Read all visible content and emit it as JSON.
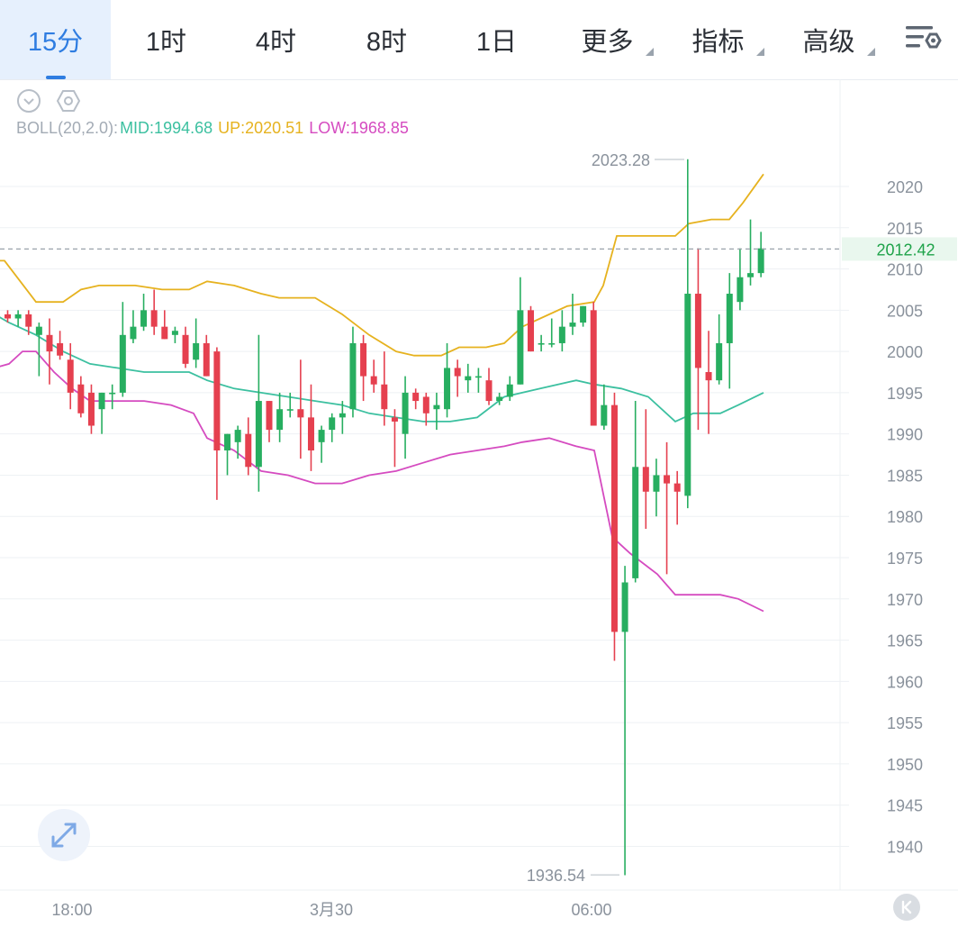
{
  "tabs": [
    {
      "label": "15分",
      "active": true
    },
    {
      "label": "1时"
    },
    {
      "label": "4时"
    },
    {
      "label": "8时"
    },
    {
      "label": "1日"
    },
    {
      "label": "更多",
      "dropdown": true
    },
    {
      "label": "指标",
      "dropdown": true
    },
    {
      "label": "高级",
      "dropdown": true
    }
  ],
  "icons": {
    "settings": "chart-settings-icon",
    "collapse": "chevron-down-circle-icon",
    "indicator_settings": "hexagon-settings-icon",
    "fullscreen": "expand-arrows-icon",
    "k": "k-icon"
  },
  "boll": {
    "name": "BOLL(20,2.0):",
    "mid": "MID:1994.68",
    "up": "UP:2020.51",
    "low": "LOW:1968.85"
  },
  "colors": {
    "accent": "#2f7de1",
    "up_candle": "#27ae60",
    "down_candle": "#e5404f",
    "mid": "#3cc0a0",
    "upper": "#e6b21f",
    "lower": "#d54bc0",
    "last_price": "#1fa34a"
  },
  "chart_data": {
    "type": "candlestick",
    "interval": "15分",
    "ylim": [
      1934,
      2026
    ],
    "y_ticks": [
      2020,
      2015,
      2010,
      2005,
      2000,
      1995,
      1990,
      1985,
      1980,
      1975,
      1970,
      1965,
      1960,
      1955,
      1950,
      1945,
      1940
    ],
    "x_ticks": [
      "18:00",
      "3月30",
      "06:00"
    ],
    "last_price": 2012.42,
    "max_label": "2023.28",
    "min_label": "1936.54",
    "candles": [
      [
        2004.5,
        2005.0,
        2003.5,
        2004.0
      ],
      [
        2004.0,
        2005.0,
        2003.0,
        2004.5
      ],
      [
        2004.5,
        2005.0,
        2002.0,
        2003.0
      ],
      [
        2002.0,
        2003.5,
        1997.0,
        2003.0
      ],
      [
        2002.0,
        2004.0,
        1996.0,
        2000.0
      ],
      [
        2001.0,
        2002.5,
        1999.0,
        1999.5
      ],
      [
        1999.0,
        2001.0,
        1993.0,
        1995.0
      ],
      [
        1996.0,
        1997.0,
        1992.0,
        1992.5
      ],
      [
        1995.0,
        1996.0,
        1990.0,
        1991.0
      ],
      [
        1993.0,
        1995.0,
        1990.0,
        1995.0
      ],
      [
        1995.0,
        1996.0,
        1993.0,
        1995.0
      ],
      [
        1995.0,
        2006.0,
        1994.5,
        2002.0
      ],
      [
        2001.5,
        2005.0,
        2001.0,
        2003.0
      ],
      [
        2003.0,
        2007.0,
        2002.5,
        2005.0
      ],
      [
        2005.0,
        2007.5,
        2002.0,
        2003.0
      ],
      [
        2003.0,
        2005.0,
        2001.5,
        2001.5
      ],
      [
        2002.0,
        2003.0,
        2001.0,
        2002.5
      ],
      [
        2002.0,
        2003.0,
        1998.0,
        1998.5
      ],
      [
        1999.0,
        2004.0,
        1998.0,
        2001.0
      ],
      [
        2001.0,
        2002.0,
        1997.0,
        1997.0
      ],
      [
        2000.0,
        2000.5,
        1982.0,
        1988.0
      ],
      [
        1988.0,
        1990.0,
        1985.0,
        1990.0
      ],
      [
        1989.0,
        1991.0,
        1987.0,
        1990.5
      ],
      [
        1990.0,
        1992.0,
        1985.0,
        1986.0
      ],
      [
        1986.0,
        2002.0,
        1983.0,
        1994.0
      ],
      [
        1994.0,
        1994.0,
        1989.0,
        1990.5
      ],
      [
        1990.5,
        1995.0,
        1989.0,
        1993.0
      ],
      [
        1993.0,
        1995.0,
        1992.0,
        1993.0
      ],
      [
        1993.0,
        1999.0,
        1987.0,
        1992.0
      ],
      [
        1992.0,
        1996.0,
        1985.5,
        1988.0
      ],
      [
        1989.0,
        1991.0,
        1986.5,
        1990.5
      ],
      [
        1990.5,
        1992.5,
        1989.0,
        1992.0
      ],
      [
        1992.0,
        1994.0,
        1990.0,
        1992.5
      ],
      [
        1993.0,
        2003.0,
        1992.0,
        2001.0
      ],
      [
        2001.0,
        2002.0,
        1994.0,
        1997.0
      ],
      [
        1997.0,
        1999.0,
        1995.0,
        1996.0
      ],
      [
        1996.0,
        2000.0,
        1991.0,
        1993.0
      ],
      [
        1992.0,
        1993.0,
        1986.0,
        1991.5
      ],
      [
        1990.0,
        1997.0,
        1987.0,
        1995.0
      ],
      [
        1995.0,
        1995.5,
        1993.0,
        1994.0
      ],
      [
        1994.5,
        1995.0,
        1991.0,
        1992.5
      ],
      [
        1993.0,
        1995.0,
        1990.5,
        1993.5
      ],
      [
        1993.0,
        2001.0,
        1992.0,
        1998.0
      ],
      [
        1998.0,
        1999.0,
        1994.5,
        1997.0
      ],
      [
        1996.5,
        1998.5,
        1995.0,
        1997.0
      ],
      [
        1997.0,
        1998.0,
        1995.0,
        1997.0
      ],
      [
        1996.5,
        1998.0,
        1993.5,
        1994.0
      ],
      [
        1994.0,
        1995.0,
        1993.5,
        1994.5
      ],
      [
        1994.5,
        1997.0,
        1994.0,
        1996.0
      ],
      [
        1996.0,
        2009.0,
        1996.0,
        2005.0
      ],
      [
        2005.0,
        2005.5,
        2000.0,
        2000.0
      ],
      [
        2001.0,
        2002.0,
        2000.0,
        2001.0
      ],
      [
        2001.0,
        2004.0,
        2000.5,
        2001.0
      ],
      [
        2001.0,
        2005.0,
        2000.0,
        2003.0
      ],
      [
        2003.0,
        2007.0,
        2002.0,
        2003.5
      ],
      [
        2003.5,
        2005.5,
        2003.0,
        2005.5
      ],
      [
        2005.0,
        2006.0,
        1995.0,
        1991.0
      ],
      [
        1991.0,
        1996.0,
        1990.5,
        1993.5
      ],
      [
        1993.5,
        1995.0,
        1962.5,
        1966.0
      ],
      [
        1966.0,
        1974.0,
        1936.5,
        1972.0
      ],
      [
        1972.5,
        1994.0,
        1972.0,
        1986.0
      ],
      [
        1986.0,
        1993.0,
        1978.5,
        1983.0
      ],
      [
        1983.0,
        1987.0,
        1980.0,
        1985.0
      ],
      [
        1985.0,
        1989.0,
        1973.0,
        1984.0
      ],
      [
        1984.0,
        1985.5,
        1979.0,
        1983.0
      ],
      [
        1982.5,
        2023.3,
        1981.0,
        2007.0
      ],
      [
        2007.0,
        2012.5,
        1990.5,
        1998.0
      ],
      [
        1997.5,
        2002.5,
        1990.0,
        1996.5
      ],
      [
        1996.5,
        2004.5,
        1996.0,
        2001.0
      ],
      [
        2001.0,
        2009.5,
        1995.5,
        2007.0
      ],
      [
        2006.0,
        2012.5,
        2005.0,
        2009.0
      ],
      [
        2009.0,
        2016.0,
        2008.0,
        2009.5
      ],
      [
        2009.5,
        2014.5,
        2009.0,
        2012.5
      ]
    ],
    "bands": {
      "upper": [
        [
          -6,
          2011.0
        ],
        [
          5,
          2011.0
        ],
        [
          40,
          2006.0
        ],
        [
          70,
          2006.0
        ],
        [
          90,
          2007.5
        ],
        [
          110,
          2008.0
        ],
        [
          150,
          2008.0
        ],
        [
          180,
          2007.5
        ],
        [
          210,
          2007.5
        ],
        [
          230,
          2008.5
        ],
        [
          260,
          2008.0
        ],
        [
          290,
          2007.0
        ],
        [
          310,
          2006.5
        ],
        [
          350,
          2006.5
        ],
        [
          380,
          2004.5
        ],
        [
          410,
          2002.0
        ],
        [
          440,
          2000.0
        ],
        [
          460,
          1999.5
        ],
        [
          490,
          1999.5
        ],
        [
          510,
          2000.5
        ],
        [
          540,
          2000.5
        ],
        [
          560,
          2001.0
        ],
        [
          580,
          2003.0
        ],
        [
          600,
          2004.0
        ],
        [
          630,
          2005.5
        ],
        [
          660,
          2006.0
        ],
        [
          670,
          2008.0
        ],
        [
          685,
          2014.0
        ],
        [
          720,
          2014.0
        ],
        [
          750,
          2014.0
        ],
        [
          765,
          2015.5
        ],
        [
          790,
          2016.0
        ],
        [
          810,
          2016.0
        ],
        [
          825,
          2018.0
        ],
        [
          848,
          2021.5
        ]
      ],
      "mid": [
        [
          -6,
          2004.5
        ],
        [
          10,
          2003.5
        ],
        [
          40,
          2002.0
        ],
        [
          70,
          2000.0
        ],
        [
          100,
          1998.5
        ],
        [
          130,
          1998.0
        ],
        [
          160,
          1997.5
        ],
        [
          190,
          1997.5
        ],
        [
          210,
          1997.5
        ],
        [
          230,
          1996.5
        ],
        [
          260,
          1995.5
        ],
        [
          290,
          1995.0
        ],
        [
          320,
          1994.5
        ],
        [
          350,
          1994.0
        ],
        [
          380,
          1993.5
        ],
        [
          410,
          1992.5
        ],
        [
          440,
          1992.0
        ],
        [
          470,
          1991.5
        ],
        [
          500,
          1991.5
        ],
        [
          530,
          1992.0
        ],
        [
          560,
          1994.5
        ],
        [
          600,
          1995.5
        ],
        [
          640,
          1996.5
        ],
        [
          660,
          1996.0
        ],
        [
          690,
          1995.5
        ],
        [
          720,
          1994.5
        ],
        [
          750,
          1991.5
        ],
        [
          770,
          1992.5
        ],
        [
          800,
          1992.5
        ],
        [
          820,
          1993.5
        ],
        [
          848,
          1995.0
        ]
      ],
      "lower": [
        [
          -6,
          1998.0
        ],
        [
          10,
          1998.5
        ],
        [
          25,
          2000.0
        ],
        [
          40,
          2000.0
        ],
        [
          60,
          1997.5
        ],
        [
          80,
          1995.5
        ],
        [
          100,
          1994.0
        ],
        [
          130,
          1994.0
        ],
        [
          160,
          1994.0
        ],
        [
          190,
          1993.5
        ],
        [
          215,
          1992.5
        ],
        [
          230,
          1989.5
        ],
        [
          260,
          1988.0
        ],
        [
          290,
          1985.5
        ],
        [
          320,
          1985.0
        ],
        [
          350,
          1984.0
        ],
        [
          380,
          1984.0
        ],
        [
          410,
          1985.0
        ],
        [
          440,
          1985.5
        ],
        [
          470,
          1986.5
        ],
        [
          500,
          1987.5
        ],
        [
          530,
          1988.0
        ],
        [
          560,
          1988.5
        ],
        [
          580,
          1989.0
        ],
        [
          610,
          1989.5
        ],
        [
          640,
          1988.5
        ],
        [
          660,
          1988.0
        ],
        [
          680,
          1977.5
        ],
        [
          700,
          1975.5
        ],
        [
          730,
          1973.0
        ],
        [
          750,
          1970.5
        ],
        [
          770,
          1970.5
        ],
        [
          800,
          1970.5
        ],
        [
          820,
          1970.0
        ],
        [
          848,
          1968.5
        ]
      ]
    }
  }
}
